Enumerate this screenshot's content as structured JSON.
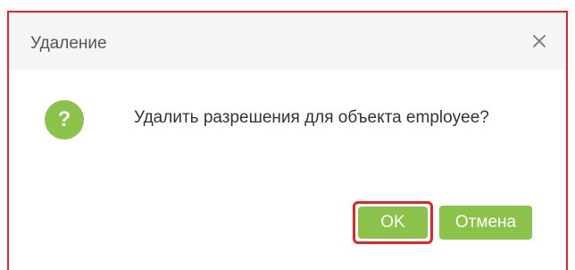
{
  "dialog": {
    "title": "Удаление",
    "message": "Удалить разрешения для объекта employee?",
    "icon_text": "?",
    "ok_label": "OK",
    "cancel_label": "Отмена"
  },
  "icons": {
    "close": "close-icon",
    "question": "question-icon"
  },
  "colors": {
    "accent": "#8bc34a",
    "highlight_border": "#e2252b",
    "header_bg": "#f5f5f5"
  }
}
